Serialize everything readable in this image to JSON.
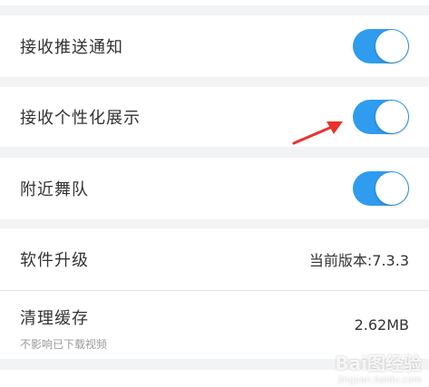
{
  "settings": {
    "push_notifications": {
      "label": "接收推送通知",
      "enabled": true
    },
    "personalized_display": {
      "label": "接收个性化展示",
      "enabled": true
    },
    "nearby_dance_team": {
      "label": "附近舞队",
      "enabled": true
    },
    "software_upgrade": {
      "label": "软件升级",
      "value": "当前版本:7.3.3"
    },
    "clear_cache": {
      "label": "清理缓存",
      "sublabel": "不影响已下载视频",
      "value": "2.62MB"
    }
  },
  "colors": {
    "toggle_on": "#2f9cf0",
    "annotation_arrow": "#e8322b",
    "background": "#f2f3f5"
  },
  "watermark": {
    "main": "Bai图经验",
    "sub": "jingyan.baidu.com"
  }
}
